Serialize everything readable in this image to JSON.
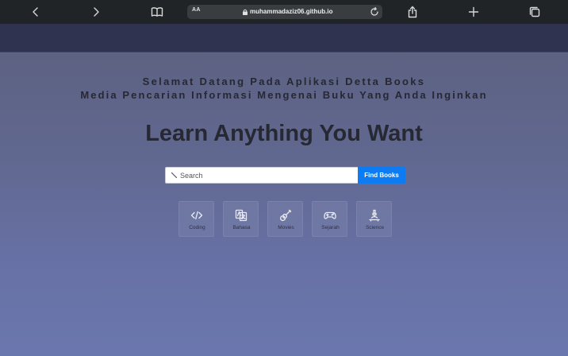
{
  "browser": {
    "text_size_label": "AA",
    "url": "muhammadaziz06.github.io",
    "buttons": [
      "back",
      "forward",
      "bookmarks",
      "share",
      "new-tab",
      "tabs"
    ]
  },
  "hero": {
    "welcome_line1": "Selamat Datang Pada Aplikasi Detta Books",
    "welcome_line2": "Media Pencarian Informasi Mengenai Buku Yang Anda Inginkan",
    "headline": "Learn Anything You Want"
  },
  "search": {
    "placeholder": "Search",
    "button_label": "Find Books"
  },
  "categories": [
    {
      "label": "Coding",
      "icon": "code-icon"
    },
    {
      "label": "Bahasa",
      "icon": "language-icon"
    },
    {
      "label": "Movies",
      "icon": "guitar-icon"
    },
    {
      "label": "Sejarah",
      "icon": "gamepad-icon"
    },
    {
      "label": "Science",
      "icon": "microscope-icon"
    }
  ],
  "colors": {
    "chrome_bg": "#212426",
    "nav_bg": "#2f3350",
    "accent": "#0d7cf2",
    "text_dark": "#262833"
  }
}
